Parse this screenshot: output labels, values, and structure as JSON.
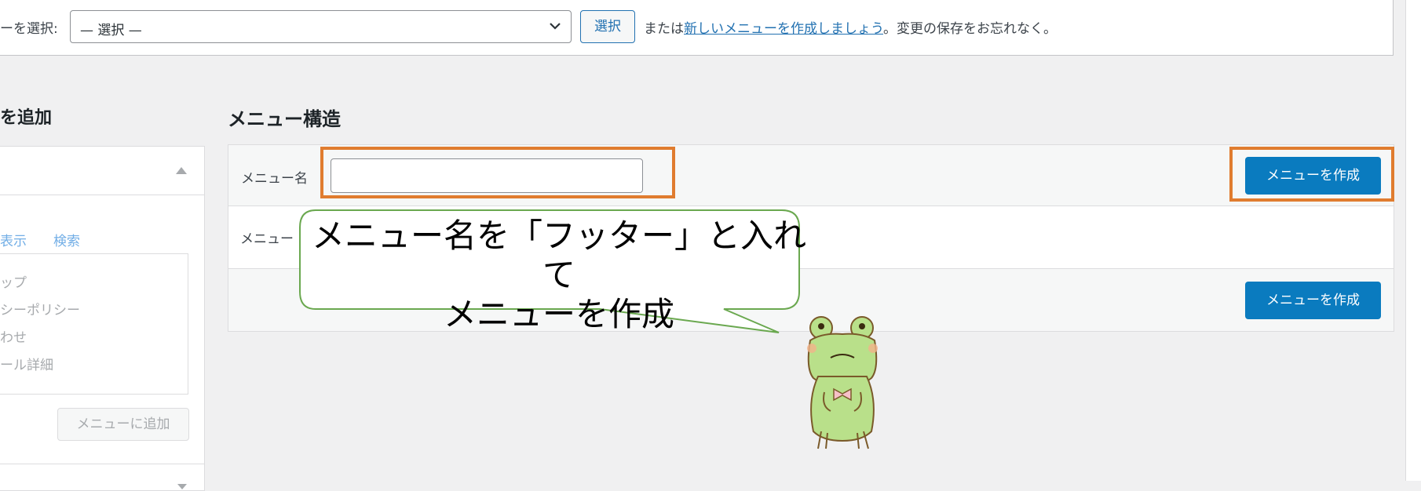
{
  "topbar": {
    "select_label": "ーを選択:",
    "select_value": "— 選択 —",
    "select_button": "選択",
    "or_text": "または",
    "create_link": "新しいメニューを作成しましょう",
    "suffix_text": "。変更の保存をお忘れなく。"
  },
  "left_panel": {
    "title": "を追加",
    "tabs": [
      "表示",
      "検索"
    ],
    "items": [
      "ップ",
      "シーポリシー",
      "わせ",
      "ール詳細"
    ],
    "add_button": "メニューに追加"
  },
  "main": {
    "title": "メニュー構造",
    "name_label": "メニュー名",
    "name_value": "",
    "row2_label": "メニュー",
    "create_button_top": "メニューを作成",
    "create_button_bottom": "メニューを作成"
  },
  "annotation": {
    "line1": "メニュー名を「フッター」と入れて",
    "line2": "メニューを作成"
  },
  "colors": {
    "primary": "#0a7bbf",
    "highlight": "#e07c2f",
    "bubble_border": "#6aa84f",
    "link": "#2271b1"
  }
}
